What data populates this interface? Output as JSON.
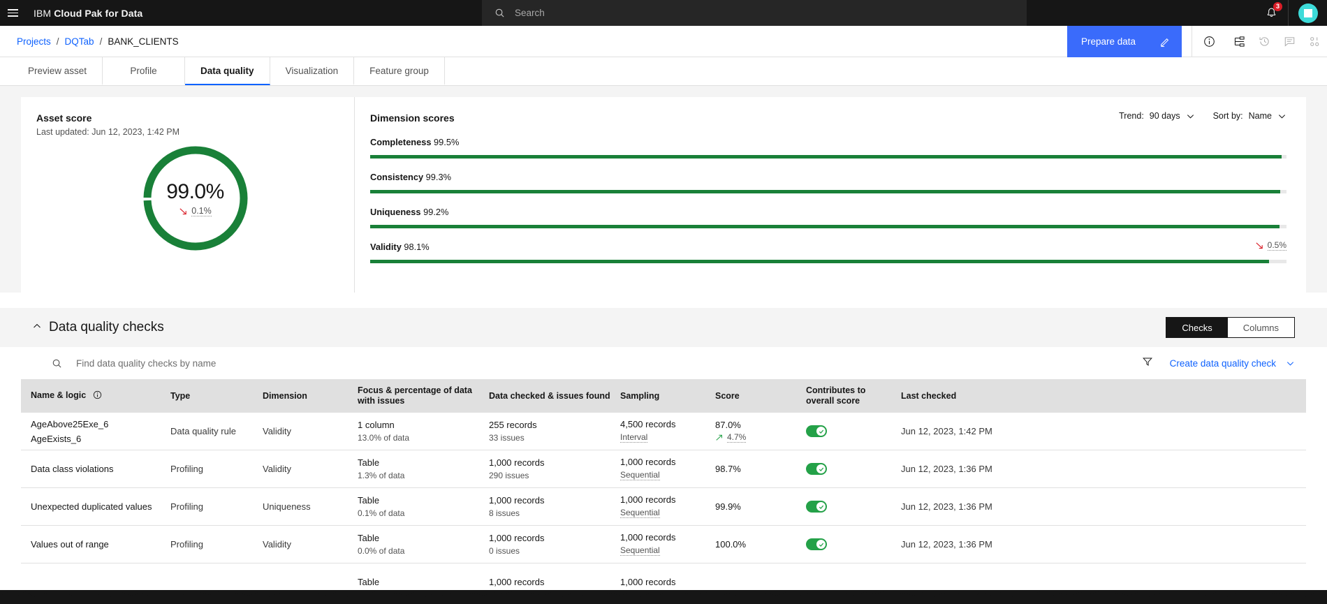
{
  "topbar": {
    "menu_icon": "hamburger-icon",
    "brand_prefix": "IBM",
    "brand_name": "Cloud Pak for Data",
    "search_placeholder": "Search",
    "search_icon": "search-icon",
    "notification_icon": "bell-icon",
    "notification_count": "3",
    "avatar_icon": "user-avatar"
  },
  "breadcrumb": {
    "projects": "Projects",
    "separator": "/",
    "project": "DQTab",
    "asset": "BANK_CLIENTS",
    "prepare_button": "Prepare data",
    "prepare_icon": "pencil-icon",
    "actions": [
      "info-icon",
      "lineage-icon",
      "history-icon",
      "comment-icon",
      "code-icon"
    ]
  },
  "tabs": [
    {
      "label": "Preview asset",
      "active": false
    },
    {
      "label": "Profile",
      "active": false
    },
    {
      "label": "Data quality",
      "active": true
    },
    {
      "label": "Visualization",
      "active": false
    },
    {
      "label": "Feature group",
      "active": false
    }
  ],
  "asset_score": {
    "title": "Asset score",
    "last_updated": "Last updated: Jun 12, 2023, 1:42 PM",
    "value": "99.0%",
    "delta": "0.1%",
    "delta_direction": "down",
    "ring_color": "#198038"
  },
  "dimension_scores": {
    "title": "Dimension scores",
    "trend_label": "Trend:",
    "trend_value": "90 days",
    "sort_label": "Sort by:",
    "sort_value": "Name",
    "items": [
      {
        "name": "Completeness",
        "score": "99.5%",
        "pct": 99.5,
        "delta": "",
        "delta_direction": ""
      },
      {
        "name": "Consistency",
        "score": "99.3%",
        "pct": 99.3,
        "delta": "",
        "delta_direction": ""
      },
      {
        "name": "Uniqueness",
        "score": "99.2%",
        "pct": 99.2,
        "delta": "",
        "delta_direction": ""
      },
      {
        "name": "Validity",
        "score": "98.1%",
        "pct": 98.1,
        "delta": "0.5%",
        "delta_direction": "down"
      }
    ]
  },
  "checks": {
    "section_title": "Data quality checks",
    "collapse_icon": "chevron-up-icon",
    "view_checks": "Checks",
    "view_columns": "Columns",
    "search_placeholder": "Find data quality checks by name",
    "search_icon": "search-icon",
    "filter_icon": "filter-icon",
    "create_label": "Create data quality check",
    "create_chevron": "chevron-down-icon",
    "columns": [
      "Name & logic",
      "Type",
      "Dimension",
      "Focus & percentage of data with issues",
      "Data checked & issues found",
      "Sampling",
      "Score",
      "Contributes to overall score",
      "Last checked"
    ],
    "name_info_icon": "info-icon",
    "rows": [
      {
        "name": "AgeAbove25Exe_6",
        "name_line2": "AgeExists_6",
        "type": "Data quality rule",
        "dimension": "Validity",
        "focus": "1 column",
        "focus_sub": "13.0% of data",
        "checked": "255 records",
        "checked_sub": "33 issues",
        "sampling": "4,500 records",
        "sampling_sub": "Interval",
        "score": "87.0%",
        "score_delta": "4.7%",
        "score_direction": "up",
        "contributes": true,
        "last_checked": "Jun 12, 2023, 1:42 PM"
      },
      {
        "name": "Data class violations",
        "name_line2": "",
        "type": "Profiling",
        "dimension": "Validity",
        "focus": "Table",
        "focus_sub": "1.3% of data",
        "checked": "1,000 records",
        "checked_sub": "290 issues",
        "sampling": "1,000 records",
        "sampling_sub": "Sequential",
        "score": "98.7%",
        "score_delta": "",
        "score_direction": "",
        "contributes": true,
        "last_checked": "Jun 12, 2023, 1:36 PM"
      },
      {
        "name": "Unexpected duplicated values",
        "name_line2": "",
        "type": "Profiling",
        "dimension": "Uniqueness",
        "focus": "Table",
        "focus_sub": "0.1% of data",
        "checked": "1,000 records",
        "checked_sub": "8 issues",
        "sampling": "1,000 records",
        "sampling_sub": "Sequential",
        "score": "99.9%",
        "score_delta": "",
        "score_direction": "",
        "contributes": true,
        "last_checked": "Jun 12, 2023, 1:36 PM"
      },
      {
        "name": "Values out of range",
        "name_line2": "",
        "type": "Profiling",
        "dimension": "Validity",
        "focus": "Table",
        "focus_sub": "0.0% of data",
        "checked": "1,000 records",
        "checked_sub": "0 issues",
        "sampling": "1,000 records",
        "sampling_sub": "Sequential",
        "score": "100.0%",
        "score_delta": "",
        "score_direction": "",
        "contributes": true,
        "last_checked": "Jun 12, 2023, 1:36 PM"
      },
      {
        "name": "",
        "name_line2": "",
        "type": "",
        "dimension": "",
        "focus": "Table",
        "focus_sub": "",
        "checked": "1,000 records",
        "checked_sub": "",
        "sampling": "1,000 records",
        "sampling_sub": "",
        "score": "",
        "score_delta": "",
        "score_direction": "",
        "contributes": false,
        "last_checked": ""
      }
    ]
  },
  "colors": {
    "green": "#198038",
    "toggle_green": "#24a148",
    "blue": "#0f62fe",
    "button_blue": "#3a6bfb",
    "red": "#da1e28",
    "teal": "#3ddbd9"
  }
}
